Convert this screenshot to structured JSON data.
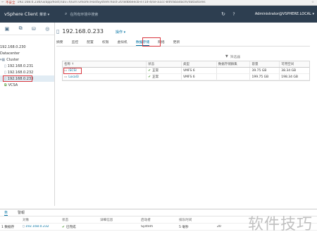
{
  "browser": {
    "security": "不安全",
    "url": "192.168.0.230/ui/app/host;nav=h/urn:vmomi:HostSystem:host-20:8db6eecb-e71d-4/se-a1cc-84fc6badacm/datastores"
  },
  "header": {
    "brand": "vSphere Client",
    "menu_label": "菜单",
    "search_placeholder": "在所有环境中搜索",
    "user": "Administrator@VSPHERE.LOCAL"
  },
  "nav": {
    "items": [
      {
        "label": "192.168.0.230"
      },
      {
        "label": "Datacenter"
      },
      {
        "label": "Cluster"
      },
      {
        "label": "192.168.0.231"
      },
      {
        "label": "192.168.0.232"
      },
      {
        "label": "192.168.0.233"
      },
      {
        "label": "VCSA"
      }
    ]
  },
  "main": {
    "host_name": "192.168.0.233",
    "actions_label": "操作",
    "tabs": [
      "摘要",
      "监控",
      "配置",
      "权限",
      "虚拟机",
      "数据存储",
      "网络",
      "更新"
    ],
    "filter_placeholder": "筛选器"
  },
  "grid": {
    "headers": [
      "名称 ↑",
      "状态",
      "类型",
      "数据存储群集",
      "容量",
      "可用空间"
    ],
    "rows": [
      {
        "name": "iSCSI",
        "status": "正常",
        "type": "VMFS 6",
        "cluster": "",
        "capacity": "39.75 GB",
        "free": "38.34 GB"
      },
      {
        "name": "Local3",
        "status": "正常",
        "type": "VMFS 6",
        "cluster": "",
        "capacity": "199.75 GB",
        "free": "198.34 GB"
      }
    ]
  },
  "bottom": {
    "tabs": [
      "务",
      "警報"
    ],
    "headers": [
      "",
      "对象",
      "状态",
      "详细信息",
      "启动者",
      "排队时间",
      ""
    ],
    "row": {
      "task": "1 数据存",
      "object": "192.168.0.232",
      "status": "已完成",
      "details": "",
      "initiator": "System",
      "queued": "5 毫秒",
      "time": "20"
    }
  },
  "watermark": "软件技巧"
}
